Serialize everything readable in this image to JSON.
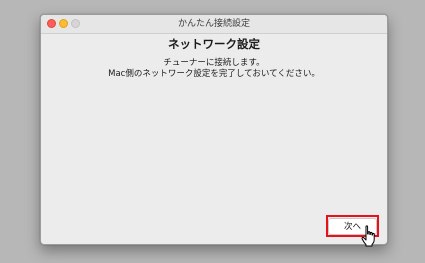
{
  "window": {
    "title": "かんたん接続設定"
  },
  "main": {
    "heading": "ネットワーク設定",
    "message_line1": "チューナーに接続します。",
    "message_line2": "Mac側のネットワーク設定を完了しておいてください。"
  },
  "footer": {
    "next_label": "次へ"
  },
  "colors": {
    "highlight": "#e8101a",
    "close": "#ff5f57",
    "minimize": "#febc2e"
  },
  "icons": {
    "cursor": "hand-pointer-icon"
  }
}
